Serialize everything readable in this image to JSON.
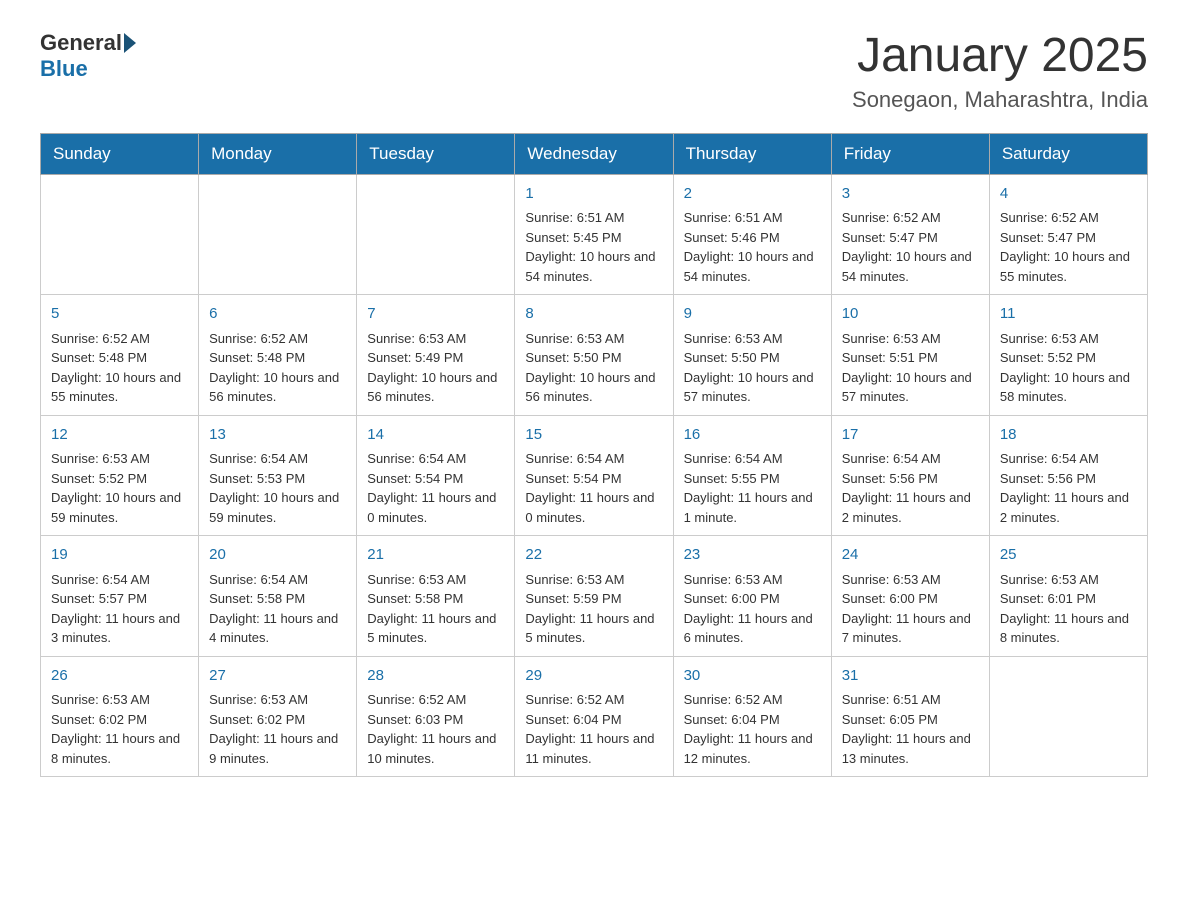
{
  "logo": {
    "general": "General",
    "blue": "Blue"
  },
  "header": {
    "month_title": "January 2025",
    "location": "Sonegaon, Maharashtra, India"
  },
  "days_of_week": [
    "Sunday",
    "Monday",
    "Tuesday",
    "Wednesday",
    "Thursday",
    "Friday",
    "Saturday"
  ],
  "weeks": [
    [
      {
        "day": "",
        "data": ""
      },
      {
        "day": "",
        "data": ""
      },
      {
        "day": "",
        "data": ""
      },
      {
        "day": "1",
        "data": "Sunrise: 6:51 AM\nSunset: 5:45 PM\nDaylight: 10 hours and 54 minutes."
      },
      {
        "day": "2",
        "data": "Sunrise: 6:51 AM\nSunset: 5:46 PM\nDaylight: 10 hours and 54 minutes."
      },
      {
        "day": "3",
        "data": "Sunrise: 6:52 AM\nSunset: 5:47 PM\nDaylight: 10 hours and 54 minutes."
      },
      {
        "day": "4",
        "data": "Sunrise: 6:52 AM\nSunset: 5:47 PM\nDaylight: 10 hours and 55 minutes."
      }
    ],
    [
      {
        "day": "5",
        "data": "Sunrise: 6:52 AM\nSunset: 5:48 PM\nDaylight: 10 hours and 55 minutes."
      },
      {
        "day": "6",
        "data": "Sunrise: 6:52 AM\nSunset: 5:48 PM\nDaylight: 10 hours and 56 minutes."
      },
      {
        "day": "7",
        "data": "Sunrise: 6:53 AM\nSunset: 5:49 PM\nDaylight: 10 hours and 56 minutes."
      },
      {
        "day": "8",
        "data": "Sunrise: 6:53 AM\nSunset: 5:50 PM\nDaylight: 10 hours and 56 minutes."
      },
      {
        "day": "9",
        "data": "Sunrise: 6:53 AM\nSunset: 5:50 PM\nDaylight: 10 hours and 57 minutes."
      },
      {
        "day": "10",
        "data": "Sunrise: 6:53 AM\nSunset: 5:51 PM\nDaylight: 10 hours and 57 minutes."
      },
      {
        "day": "11",
        "data": "Sunrise: 6:53 AM\nSunset: 5:52 PM\nDaylight: 10 hours and 58 minutes."
      }
    ],
    [
      {
        "day": "12",
        "data": "Sunrise: 6:53 AM\nSunset: 5:52 PM\nDaylight: 10 hours and 59 minutes."
      },
      {
        "day": "13",
        "data": "Sunrise: 6:54 AM\nSunset: 5:53 PM\nDaylight: 10 hours and 59 minutes."
      },
      {
        "day": "14",
        "data": "Sunrise: 6:54 AM\nSunset: 5:54 PM\nDaylight: 11 hours and 0 minutes."
      },
      {
        "day": "15",
        "data": "Sunrise: 6:54 AM\nSunset: 5:54 PM\nDaylight: 11 hours and 0 minutes."
      },
      {
        "day": "16",
        "data": "Sunrise: 6:54 AM\nSunset: 5:55 PM\nDaylight: 11 hours and 1 minute."
      },
      {
        "day": "17",
        "data": "Sunrise: 6:54 AM\nSunset: 5:56 PM\nDaylight: 11 hours and 2 minutes."
      },
      {
        "day": "18",
        "data": "Sunrise: 6:54 AM\nSunset: 5:56 PM\nDaylight: 11 hours and 2 minutes."
      }
    ],
    [
      {
        "day": "19",
        "data": "Sunrise: 6:54 AM\nSunset: 5:57 PM\nDaylight: 11 hours and 3 minutes."
      },
      {
        "day": "20",
        "data": "Sunrise: 6:54 AM\nSunset: 5:58 PM\nDaylight: 11 hours and 4 minutes."
      },
      {
        "day": "21",
        "data": "Sunrise: 6:53 AM\nSunset: 5:58 PM\nDaylight: 11 hours and 5 minutes."
      },
      {
        "day": "22",
        "data": "Sunrise: 6:53 AM\nSunset: 5:59 PM\nDaylight: 11 hours and 5 minutes."
      },
      {
        "day": "23",
        "data": "Sunrise: 6:53 AM\nSunset: 6:00 PM\nDaylight: 11 hours and 6 minutes."
      },
      {
        "day": "24",
        "data": "Sunrise: 6:53 AM\nSunset: 6:00 PM\nDaylight: 11 hours and 7 minutes."
      },
      {
        "day": "25",
        "data": "Sunrise: 6:53 AM\nSunset: 6:01 PM\nDaylight: 11 hours and 8 minutes."
      }
    ],
    [
      {
        "day": "26",
        "data": "Sunrise: 6:53 AM\nSunset: 6:02 PM\nDaylight: 11 hours and 8 minutes."
      },
      {
        "day": "27",
        "data": "Sunrise: 6:53 AM\nSunset: 6:02 PM\nDaylight: 11 hours and 9 minutes."
      },
      {
        "day": "28",
        "data": "Sunrise: 6:52 AM\nSunset: 6:03 PM\nDaylight: 11 hours and 10 minutes."
      },
      {
        "day": "29",
        "data": "Sunrise: 6:52 AM\nSunset: 6:04 PM\nDaylight: 11 hours and 11 minutes."
      },
      {
        "day": "30",
        "data": "Sunrise: 6:52 AM\nSunset: 6:04 PM\nDaylight: 11 hours and 12 minutes."
      },
      {
        "day": "31",
        "data": "Sunrise: 6:51 AM\nSunset: 6:05 PM\nDaylight: 11 hours and 13 minutes."
      },
      {
        "day": "",
        "data": ""
      }
    ]
  ]
}
